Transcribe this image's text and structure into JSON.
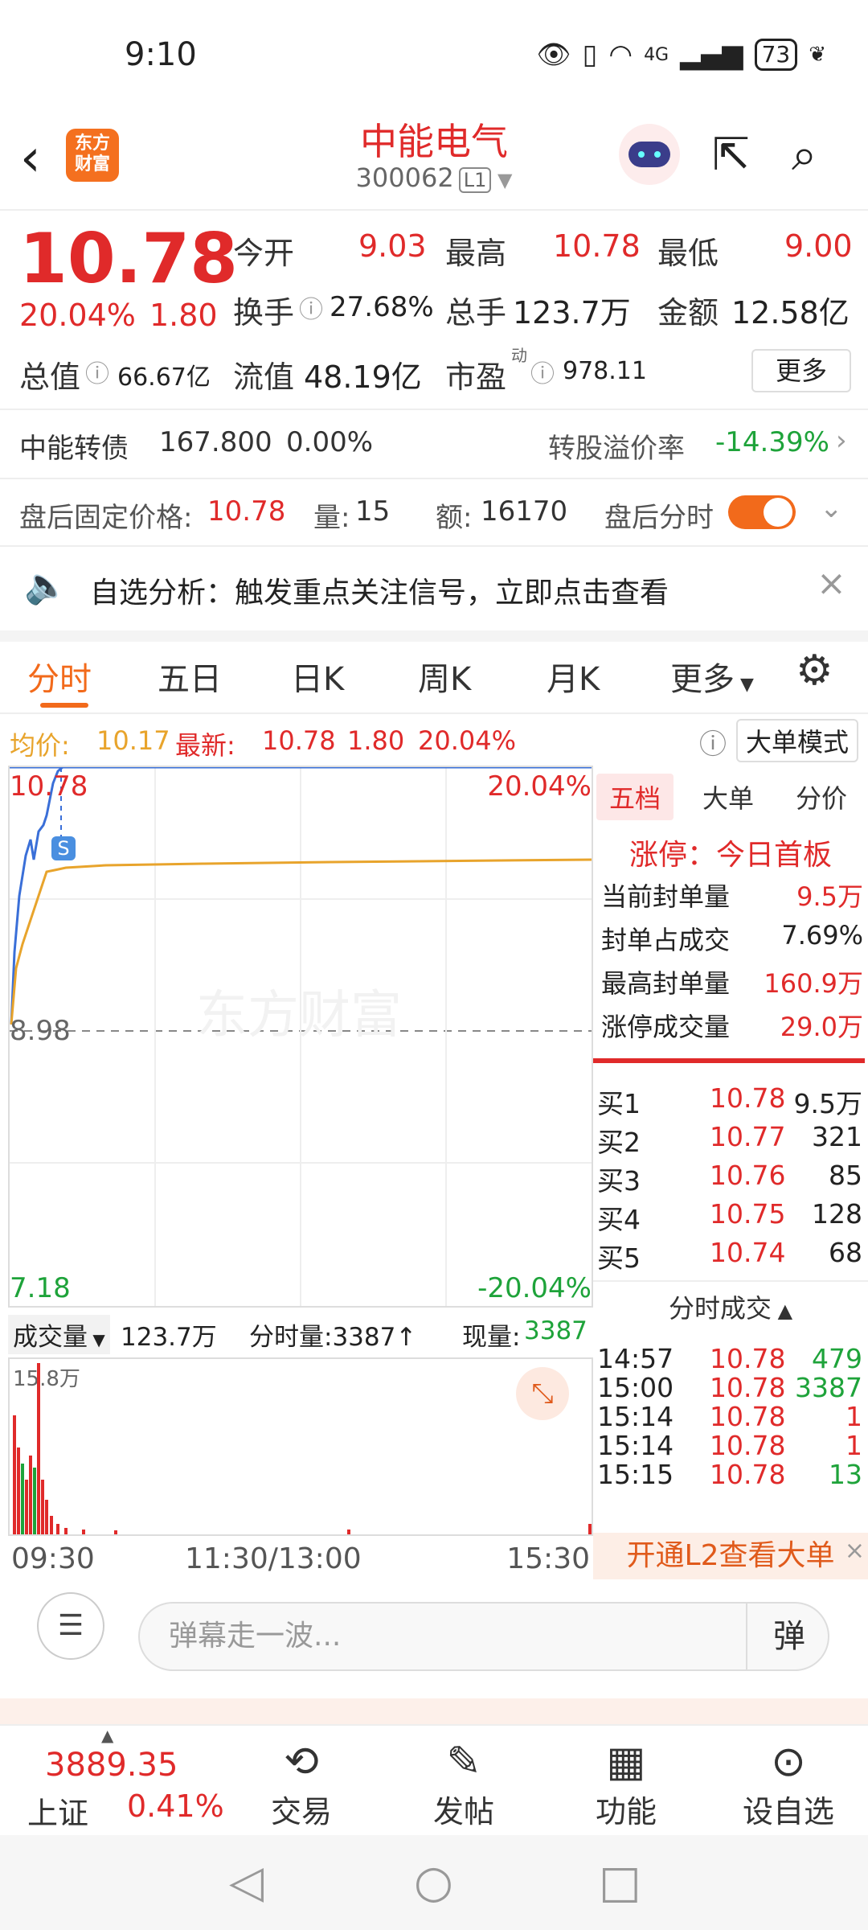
{
  "status_bar": {
    "time": "9:10",
    "battery": "73",
    "net": "4G"
  },
  "header": {
    "app_logo": "东方\n财富",
    "logo_line1": "东方",
    "logo_line2": "财富",
    "stock_name": "中能电气",
    "stock_code": "300062",
    "level": "L1"
  },
  "quote": {
    "price": "10.78",
    "pct": "20.04%",
    "change": "1.80",
    "open_label": "今开",
    "open": "9.03",
    "high_label": "最高",
    "high": "10.78",
    "low_label": "最低",
    "low": "9.00",
    "turnover_label": "换手",
    "turnover": "27.68%",
    "volume_label": "总手",
    "volume": "123.7万",
    "amount_label": "金额",
    "amount": "12.58亿",
    "mcap_label": "总值",
    "mcap": "66.67亿",
    "float_label": "流值",
    "float": "48.19亿",
    "pe_label": "市盈",
    "pe_sup": "动",
    "pe": "978.11",
    "more_label": "更多"
  },
  "bond": {
    "name": "中能转债",
    "price": "167.800",
    "pct": "0.00%",
    "premium_label": "转股溢价率",
    "premium": "-14.39%"
  },
  "afterhours": {
    "price_label": "盘后固定价格:",
    "price": "10.78",
    "vol_label": "量:",
    "vol": "15",
    "amt_label": "额:",
    "amt": "16170",
    "toggle_label": "盘后分时"
  },
  "notice": {
    "text": "自选分析：触发重点关注信号，立即点击查看"
  },
  "tabs": [
    "分时",
    "五日",
    "日K",
    "周K",
    "月K",
    "更多"
  ],
  "avgline": {
    "avg_label": "均价:",
    "avg": "10.17",
    "last_label": "最新:",
    "last": "10.78",
    "chg": "1.80",
    "pct": "20.04%",
    "mode_label": "大单模式"
  },
  "chart": {
    "top_price": "10.78",
    "top_pct": "20.04%",
    "mid_price": "8.98",
    "bottom_price": "7.18",
    "bottom_pct": "-20.04%",
    "marker": "S",
    "watermark": "东方财富"
  },
  "volume": {
    "label": "成交量",
    "total": "123.7万",
    "tick_label": "分时量:3387↑",
    "now_label": "现量:",
    "now": "3387",
    "max": "15.8万"
  },
  "times": {
    "start": "09:30",
    "mid": "11:30/13:00",
    "end": "15:30"
  },
  "right_panel": {
    "tabs": [
      "五档",
      "大单",
      "分价"
    ],
    "limit_title": "涨停：今日首板",
    "stats": [
      {
        "label": "当前封单量",
        "value": "9.5万"
      },
      {
        "label": "封单占成交",
        "value": "7.69%"
      },
      {
        "label": "最高封单量",
        "value": "160.9万"
      },
      {
        "label": "涨停成交量",
        "value": "29.0万"
      }
    ],
    "bids": [
      {
        "label": "买1",
        "price": "10.78",
        "vol": "9.5万"
      },
      {
        "label": "买2",
        "price": "10.77",
        "vol": "321"
      },
      {
        "label": "买3",
        "price": "10.76",
        "vol": "85"
      },
      {
        "label": "买4",
        "price": "10.75",
        "vol": "128"
      },
      {
        "label": "买5",
        "price": "10.74",
        "vol": "68"
      }
    ],
    "trades_header": "分时成交",
    "trades": [
      {
        "time": "14:57",
        "price": "10.78",
        "vol": "479"
      },
      {
        "time": "15:00",
        "price": "10.78",
        "vol": "3387"
      },
      {
        "time": "15:14",
        "price": "10.78",
        "vol": "1"
      },
      {
        "time": "15:14",
        "price": "10.78",
        "vol": "1"
      },
      {
        "time": "15:15",
        "price": "10.78",
        "vol": "13"
      }
    ],
    "l2_banner": "开通L2查看大单"
  },
  "danmu": {
    "placeholder": "弹幕走一波...",
    "send_label": "弹"
  },
  "bottom_nav": {
    "index_value": "3889.35",
    "index_name": "上证",
    "index_pct": "0.41%",
    "items": [
      "交易",
      "发帖",
      "功能",
      "设自选"
    ]
  },
  "colors": {
    "up": "#e02a2a",
    "down": "#1ea33a",
    "accent": "#f26a1b",
    "avg_line": "#e8a42c",
    "price_line": "#3a6fd8"
  }
}
